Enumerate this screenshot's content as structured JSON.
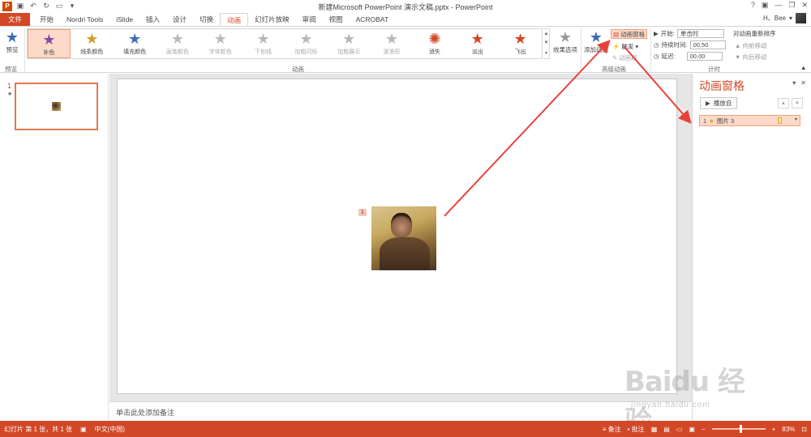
{
  "window": {
    "title": "新建Microsoft PowerPoint 演示文稿.pptx - PowerPoint",
    "help": "?",
    "minimize": "—",
    "restore": "❐",
    "close": "✕"
  },
  "tabs": [
    {
      "label": "文件"
    },
    {
      "label": "开始"
    },
    {
      "label": "Nordri Tools"
    },
    {
      "label": "iSlide"
    },
    {
      "label": "插入"
    },
    {
      "label": "设计"
    },
    {
      "label": "切换"
    },
    {
      "label": "动画"
    },
    {
      "label": "幻灯片放映"
    },
    {
      "label": "审阅"
    },
    {
      "label": "视图"
    },
    {
      "label": "ACROBAT"
    }
  ],
  "user": {
    "name": "H、Bee",
    "dropdown": "▾"
  },
  "ribbon": {
    "preview": {
      "label": "预览",
      "group": "预览"
    },
    "animation_group": "动画",
    "effects": [
      {
        "label": "补色",
        "icon": "star-icon",
        "color": "#7b4fa3",
        "selected": true,
        "enabled": true
      },
      {
        "label": "线条颜色",
        "icon": "star-icon",
        "color": "#d89a2a",
        "enabled": true
      },
      {
        "label": "填充颜色",
        "icon": "star-icon",
        "color": "#3d6bb3",
        "enabled": true
      },
      {
        "label": "画笔颜色",
        "icon": "star-icon",
        "color": "#b8b8b8",
        "enabled": false
      },
      {
        "label": "字体颜色",
        "icon": "star-icon",
        "color": "#b8b8b8",
        "enabled": false
      },
      {
        "label": "下划线",
        "icon": "star-icon",
        "color": "#b8b8b8",
        "enabled": false
      },
      {
        "label": "加粗闪烁",
        "icon": "star-icon",
        "color": "#b8b8b8",
        "enabled": false
      },
      {
        "label": "加粗展示",
        "icon": "star-icon",
        "color": "#b8b8b8",
        "enabled": false
      },
      {
        "label": "波浪形",
        "icon": "star-icon",
        "color": "#b8b8b8",
        "enabled": false
      },
      {
        "label": "消失",
        "icon": "burst-icon",
        "color": "#d24726",
        "enabled": true
      },
      {
        "label": "淡出",
        "icon": "star-icon",
        "color": "#d24726",
        "enabled": true
      },
      {
        "label": "飞出",
        "icon": "star-icon",
        "color": "#d24726",
        "enabled": true
      }
    ],
    "effect_options": "效果选项",
    "add_animation": "添加动画",
    "animation_pane": "动画窗格",
    "trigger": "触发",
    "animation_painter": "动画刷",
    "advanced_group": "高级动画",
    "timing": {
      "start_label": "开始:",
      "start_value": "单击时",
      "duration_label": "持续时间:",
      "duration_value": "00.50",
      "delay_label": "延迟:",
      "delay_value": "00.00",
      "reorder_title": "对动画重新排序",
      "move_earlier": "向前移动",
      "move_later": "向后移动",
      "group": "计时"
    }
  },
  "thumbnails": {
    "slide_number": "1",
    "star": "★"
  },
  "slide": {
    "anim_tag": "1",
    "notes_placeholder": "单击此处添加备注"
  },
  "anim_pane": {
    "title": "动画窗格",
    "play_label": "播放自",
    "items": [
      {
        "index": "1",
        "name": "图片 3"
      }
    ]
  },
  "status": {
    "slide_info": "幻灯片 第 1 张，共 1 张",
    "language": "中文(中国)",
    "notes": "备注",
    "comments": "批注",
    "zoom": "83%",
    "zoom_level": 0.83
  },
  "watermark": {
    "logo": "Baidu 经验",
    "url": "jingyan.baidu.com"
  },
  "colors": {
    "accent": "#d24726",
    "highlight": "#fcd9c8",
    "arrow": "#e8413a"
  }
}
